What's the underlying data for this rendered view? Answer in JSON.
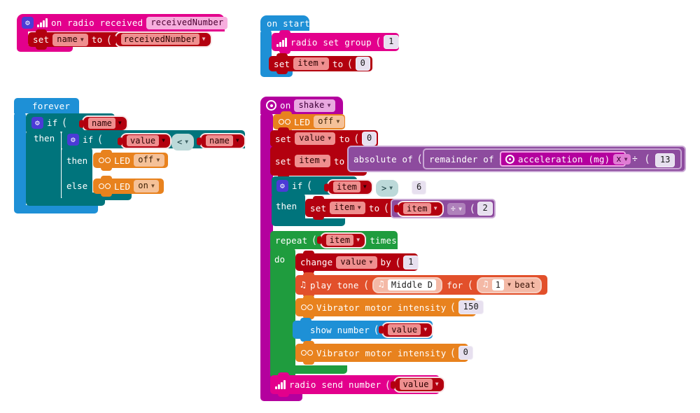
{
  "editor": {
    "name": "makecode-blocks-workspace",
    "background": "#ffffff"
  },
  "palette": {
    "radio": "#e3008c",
    "variables": "#b3000f",
    "loops": "#1f9c3e",
    "logic": "#00747c",
    "math": "#8d4b9e",
    "basic": "#1e90d6",
    "input": "#b4009e",
    "led": "#e8821e",
    "music": "#e2502b",
    "operator_pill": "#bcd9d9",
    "number_field": "#e7e0ef"
  },
  "scripts": {
    "on_radio_received": {
      "event_label": "on radio received",
      "event_param": "receivedNumber",
      "gear_icon": "gear-icon",
      "radio_icon": "radio-signal-icon",
      "body": [
        {
          "keyword_set": "set",
          "variable": "name",
          "keyword_to": "to",
          "value_reporter": "receivedNumber"
        }
      ]
    },
    "on_start": {
      "label": "on start",
      "body": [
        {
          "text": "radio set group",
          "icon": "radio-signal-icon",
          "number": "1"
        },
        {
          "keyword_set": "set",
          "variable": "item",
          "keyword_to": "to",
          "number": "0"
        }
      ]
    },
    "forever": {
      "label": "forever",
      "grid_icon": "grid-icon",
      "outer_if": {
        "gear_icon": "gear-icon",
        "if_label": "if",
        "then_label": "then",
        "condition": "name"
      },
      "inner_if": {
        "gear_icon": "gear-icon",
        "if_label": "if",
        "then_label": "then",
        "else_label": "else",
        "condition_left": "value",
        "condition_operator": "<",
        "condition_right": "name",
        "then_block": {
          "text": "LED",
          "state": "off",
          "icon": "goggles-icon"
        },
        "else_block": {
          "text": "LED",
          "state": "on",
          "icon": "goggles-icon"
        }
      }
    },
    "on_shake": {
      "event_keyword": "on",
      "event_value": "shake",
      "icon": "input-target-icon",
      "led_off": {
        "text": "LED",
        "state": "off",
        "icon": "goggles-icon"
      },
      "set_value": {
        "keyword_set": "set",
        "variable": "value",
        "keyword_to": "to",
        "number": "0"
      },
      "set_item": {
        "keyword_set": "set",
        "variable": "item",
        "keyword_to": "to",
        "abs_label": "absolute of",
        "rem_label": "remainder of",
        "accel_label": "acceleration (mg)",
        "accel_axis": "x",
        "accel_icon": "input-target-icon",
        "divide_operator": "÷",
        "divisor": "13"
      },
      "if_block": {
        "gear_icon": "gear-icon",
        "if_label": "if",
        "then_label": "then",
        "cond_left": "item",
        "cond_operator": ">",
        "cond_right": "6",
        "then_set": {
          "keyword_set": "set",
          "variable": "item",
          "keyword_to": "to",
          "left": "item",
          "operator": "÷",
          "right": "2"
        }
      },
      "repeat_block": {
        "repeat_label": "repeat",
        "times_label": "times",
        "do_label": "do",
        "count_variable": "item",
        "body": [
          {
            "kind": "change",
            "keyword": "change",
            "variable": "value",
            "by_label": "by",
            "number": "1"
          },
          {
            "kind": "play_tone",
            "label": "play tone",
            "note": "Middle D",
            "for_label": "for",
            "beats": "1",
            "beat_label": "beat",
            "icon": "music-note-icon"
          },
          {
            "kind": "vibrator",
            "label": "Vibrator motor intensity",
            "number": "150",
            "icon": "goggles-icon"
          },
          {
            "kind": "show_number",
            "label": "show number",
            "reporter": "value",
            "icon": "grid-icon"
          },
          {
            "kind": "vibrator",
            "label": "Vibrator motor intensity",
            "number": "0",
            "icon": "goggles-icon"
          }
        ]
      },
      "radio_send": {
        "label": "radio send number",
        "reporter": "value",
        "icon": "radio-signal-icon"
      }
    }
  }
}
